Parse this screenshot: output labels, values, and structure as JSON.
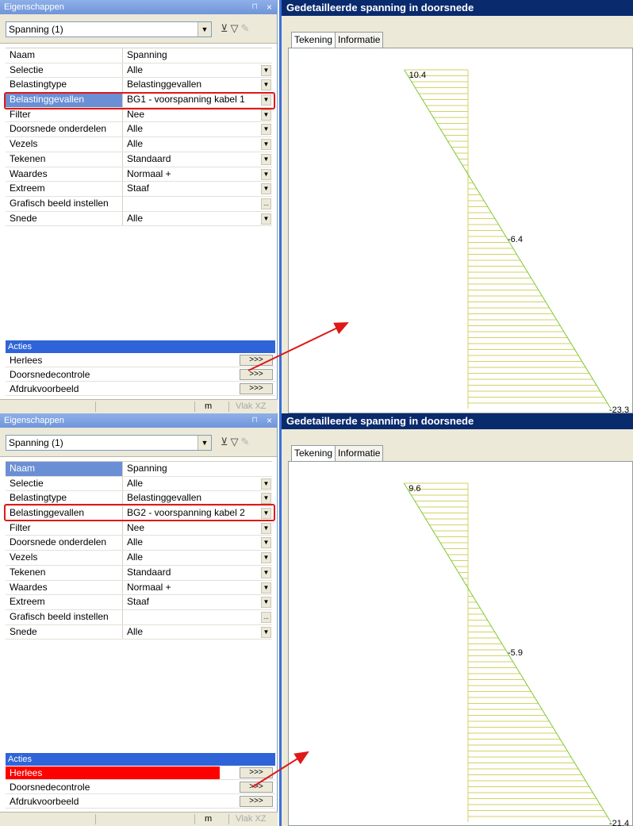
{
  "frames": [
    {
      "panel": {
        "title": "Eigenschappen",
        "pin": "⊓",
        "close": "×",
        "selector": "Spanning (1)",
        "selected_row": "belastinggevallen",
        "rows": [
          {
            "name": "Naam",
            "value": "Spanning",
            "dropdown": false
          },
          {
            "name": "Selectie",
            "value": "Alle",
            "dropdown": true
          },
          {
            "name": "Belastingtype",
            "value": "Belastinggevallen",
            "dropdown": true
          },
          {
            "name": "Belastinggevallen",
            "value": "BG1 - voorspanning kabel 1",
            "dropdown": true
          },
          {
            "name": "Filter",
            "value": "Nee",
            "dropdown": true
          },
          {
            "name": "Doorsnede onderdelen",
            "value": "Alle",
            "dropdown": true
          },
          {
            "name": "Vezels",
            "value": "Alle",
            "dropdown": true
          },
          {
            "name": "Tekenen",
            "value": "Standaard",
            "dropdown": true
          },
          {
            "name": "Waardes",
            "value": "Normaal +",
            "dropdown": true
          },
          {
            "name": "Extreem",
            "value": "Staaf",
            "dropdown": true
          },
          {
            "name": "Grafisch beeld instellen",
            "value": "",
            "dropdown": false,
            "ellipsis": "..."
          },
          {
            "name": "Snede",
            "value": "Alle",
            "dropdown": true
          }
        ],
        "acties_header": "Acties",
        "acties": [
          {
            "label": "Herlees",
            "button": ">>>",
            "highlight": false
          },
          {
            "label": "Doorsnedecontrole",
            "button": ">>>",
            "highlight": false
          },
          {
            "label": "Afdrukvoorbeeld",
            "button": ">>>",
            "highlight": false
          }
        ],
        "status_unit": "m",
        "status_plane": "Vlak XZ"
      },
      "view": {
        "title": "Gedetailleerde spanning in doorsnede",
        "tabs": [
          "Tekening",
          "Informatie"
        ],
        "top_label": "10.4",
        "mid_label": "-6.4",
        "bottom_label": "-23.3"
      }
    },
    {
      "panel": {
        "title": "Eigenschappen",
        "pin": "⊓",
        "close": "×",
        "selector": "Spanning (1)",
        "selected_row": "naam",
        "rows": [
          {
            "name": "Naam",
            "value": "Spanning",
            "dropdown": false
          },
          {
            "name": "Selectie",
            "value": "Alle",
            "dropdown": true
          },
          {
            "name": "Belastingtype",
            "value": "Belastinggevallen",
            "dropdown": true
          },
          {
            "name": "Belastinggevallen",
            "value": "BG2 - voorspanning kabel 2",
            "dropdown": true
          },
          {
            "name": "Filter",
            "value": "Nee",
            "dropdown": true
          },
          {
            "name": "Doorsnede onderdelen",
            "value": "Alle",
            "dropdown": true
          },
          {
            "name": "Vezels",
            "value": "Alle",
            "dropdown": true
          },
          {
            "name": "Tekenen",
            "value": "Standaard",
            "dropdown": true
          },
          {
            "name": "Waardes",
            "value": "Normaal +",
            "dropdown": true
          },
          {
            "name": "Extreem",
            "value": "Staaf",
            "dropdown": true
          },
          {
            "name": "Grafisch beeld instellen",
            "value": "",
            "dropdown": false,
            "ellipsis": "..."
          },
          {
            "name": "Snede",
            "value": "Alle",
            "dropdown": true
          }
        ],
        "acties_header": "Acties",
        "acties": [
          {
            "label": "Herlees",
            "button": ">>>",
            "highlight": true
          },
          {
            "label": "Doorsnedecontrole",
            "button": ">>>",
            "highlight": false
          },
          {
            "label": "Afdrukvoorbeeld",
            "button": ">>>",
            "highlight": false
          }
        ],
        "status_unit": "m",
        "status_plane": "Vlak XZ"
      },
      "view": {
        "title": "Gedetailleerde spanning in doorsnede",
        "tabs": [
          "Tekening",
          "Informatie"
        ],
        "top_label": "9.6",
        "mid_label": "-5.9",
        "bottom_label": "-21.4"
      }
    }
  ],
  "colors": {
    "highlight_box": "#e01818",
    "stress_line": "#7ec832",
    "hatch": "#d2d264",
    "arrow": "#e01818",
    "acties_header": "#2f64d8"
  }
}
